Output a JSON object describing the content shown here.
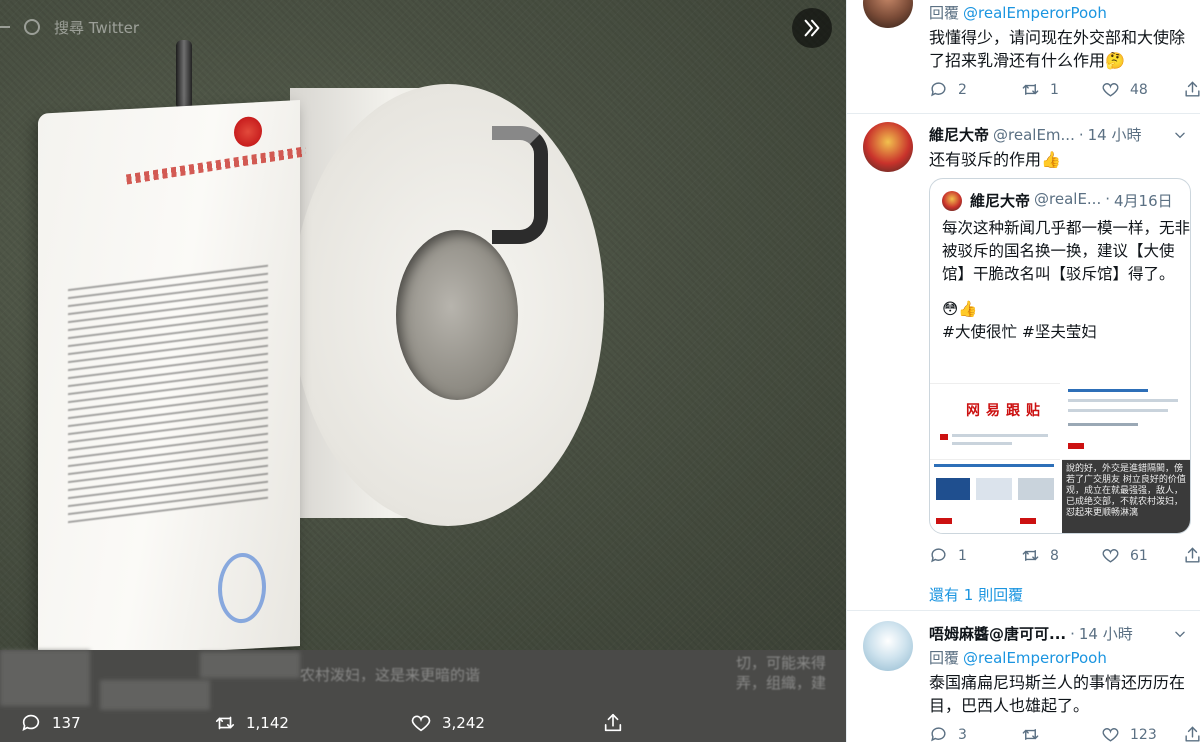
{
  "viewer": {
    "search_placeholder": "搜尋 Twitter",
    "blur_text_left": "农村泼妇，这是来更暗的谐",
    "blur_text_right": "切，可能来得",
    "blur_text_right2": "弄，组織，建",
    "actions": {
      "reply_count": "137",
      "retweet_count": "1,142",
      "like_count": "3,242"
    }
  },
  "replies": [
    {
      "id": "reply-top",
      "reply_to_label": "回覆",
      "reply_to_handle": "@realEmperorPooh",
      "text": "我懂得少，请问现在外交部和大使除了招来乳滑还有什么作用🤔",
      "stats": {
        "replies": "2",
        "retweets": "1",
        "likes": "48"
      }
    },
    {
      "id": "reply-winnie",
      "name": "維尼大帝",
      "handle": "@realEm...",
      "separator": "·",
      "time": "14 小時",
      "text": "还有驳斥的作用👍",
      "quote": {
        "name": "維尼大帝",
        "handle": "@realE...",
        "separator": "·",
        "date": "4月16日",
        "text": "每次这种新闻几乎都一模一样，无非被驳斥的国名换一换，建议【大使馆】干脆改名叫【驳斥馆】得了。",
        "emoji_line": "😳👍",
        "tags": "#大使很忙 #坚夫莹妇",
        "thumb_title": "网易跟贴",
        "thumb_dark_text": "說的好，外交是進錯隔閡，傍若了广交朋友 树立良好的价值观，成立在就最强强，敌人，已成绝交部，不就农村泼妇，怼起来更顺畅淋漓"
      },
      "stats": {
        "replies": "1",
        "retweets": "8",
        "likes": "61"
      }
    },
    {
      "id": "show-replies",
      "label": "還有 1 則回覆"
    },
    {
      "id": "reply-bottom",
      "name": "唔姆麻醬@唐可可...",
      "separator": "·",
      "time": "14 小時",
      "reply_to_label": "回覆",
      "reply_to_handle": "@realEmperorPooh",
      "text": "泰国痛扁尼玛斯兰人的事情还历历在目，巴西人也雄起了。",
      "stats": {
        "replies": "3",
        "retweets": "",
        "likes": "123"
      }
    }
  ],
  "colors": {
    "link": "#1b95e0",
    "muted": "#5b7083",
    "border": "#e6ecf0"
  }
}
